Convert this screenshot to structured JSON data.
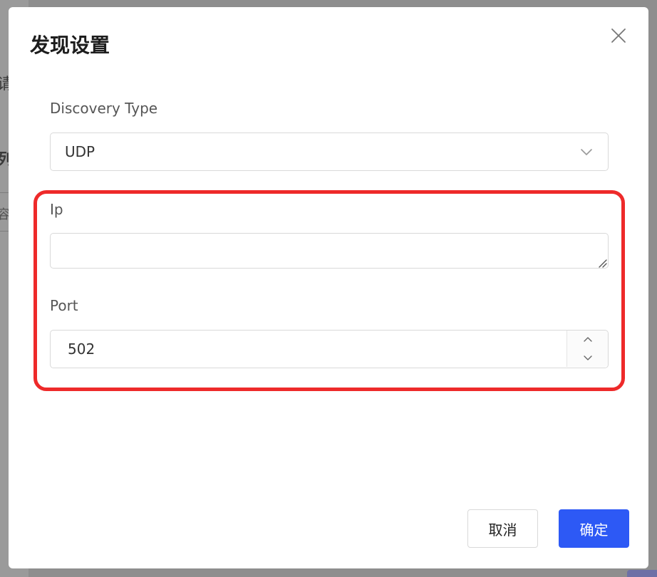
{
  "background": {
    "fragments": [
      "请",
      "列",
      "容"
    ]
  },
  "dialog": {
    "title": "发现设置",
    "close_icon": "close-icon",
    "fields": {
      "discovery_type": {
        "label": "Discovery Type",
        "value": "UDP",
        "icon": "chevron-down-icon"
      },
      "ip": {
        "label": "Ip",
        "value": "",
        "placeholder": ""
      },
      "port": {
        "label": "Port",
        "value": "502",
        "up_icon": "chevron-up-icon",
        "down_icon": "chevron-down-icon"
      }
    },
    "footer": {
      "cancel_label": "取消",
      "ok_label": "确定"
    },
    "colors": {
      "primary": "#2d59f5",
      "highlight": "#ee2a2a",
      "border": "#d9d9d9"
    }
  }
}
